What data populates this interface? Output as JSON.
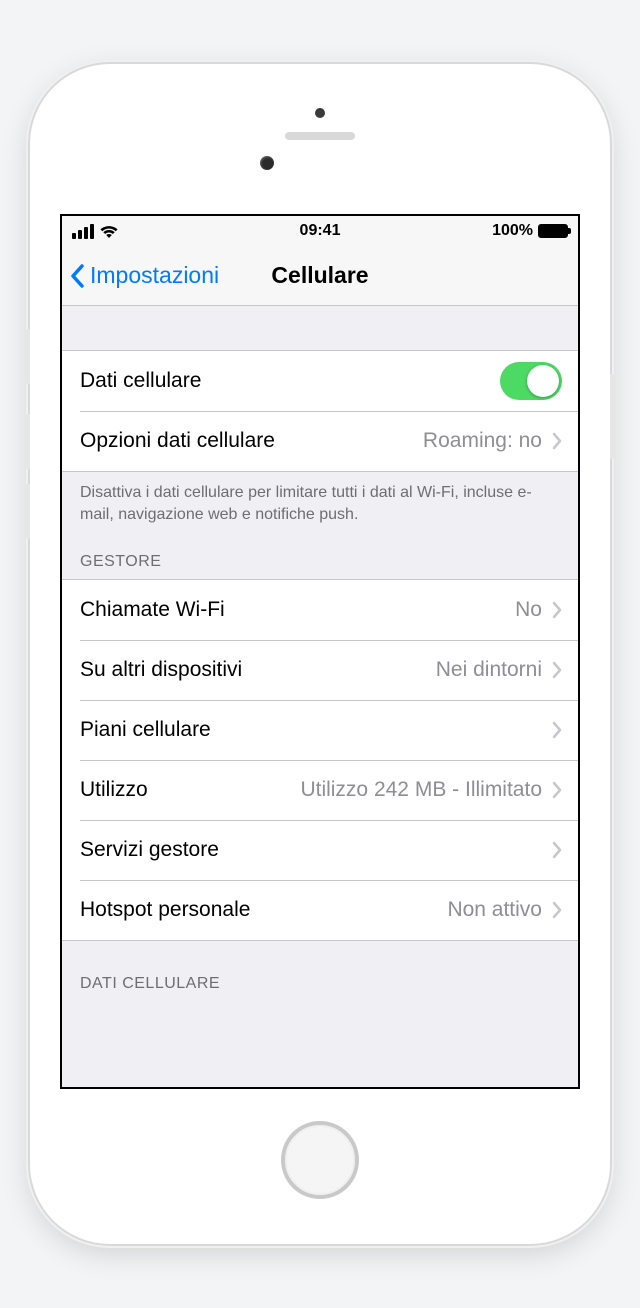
{
  "status": {
    "time": "09:41",
    "battery_pct": "100%"
  },
  "nav": {
    "back_label": "Impostazioni",
    "title": "Cellulare"
  },
  "section1": {
    "cellular_data_label": "Dati cellulare",
    "options_label": "Opzioni dati cellulare",
    "options_value": "Roaming: no",
    "footer": "Disattiva i dati cellulare per limitare tutti i dati al Wi-Fi, incluse e-mail, navigazione web e notifiche push."
  },
  "section2": {
    "header": "GESTORE",
    "wifi_calls_label": "Chiamate Wi-Fi",
    "wifi_calls_value": "No",
    "other_devices_label": "Su altri dispositivi",
    "other_devices_value": "Nei dintorni",
    "plans_label": "Piani cellulare",
    "usage_label": "Utilizzo",
    "usage_value": "Utilizzo 242 MB - Illimitato",
    "services_label": "Servizi gestore",
    "hotspot_label": "Hotspot personale",
    "hotspot_value": "Non attivo"
  },
  "section3": {
    "header": "DATI CELLULARE"
  }
}
